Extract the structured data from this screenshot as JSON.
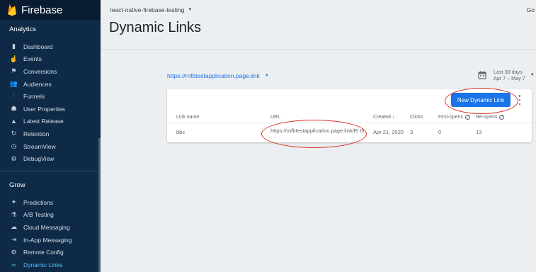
{
  "sidebar": {
    "app_name": "Firebase",
    "analytics_label": "Analytics",
    "analytics_items": [
      {
        "label": "Dashboard",
        "icon": "bar-chart-icon"
      },
      {
        "label": "Events",
        "icon": "touch-icon"
      },
      {
        "label": "Conversions",
        "icon": "flag-icon"
      },
      {
        "label": "Audiences",
        "icon": "people-icon"
      },
      {
        "label": "Funnels",
        "icon": "funnel-icon"
      },
      {
        "label": "User Properties",
        "icon": "user-properties-icon"
      },
      {
        "label": "Latest Release",
        "icon": "release-icon"
      },
      {
        "label": "Retention",
        "icon": "retention-icon"
      },
      {
        "label": "StreamView",
        "icon": "clock-icon"
      },
      {
        "label": "DebugView",
        "icon": "debug-icon"
      }
    ],
    "grow_label": "Grow",
    "grow_items": [
      {
        "label": "Predictions",
        "icon": "magic-wand-icon"
      },
      {
        "label": "A/B Testing",
        "icon": "flask-icon"
      },
      {
        "label": "Cloud Messaging",
        "icon": "cloud-icon"
      },
      {
        "label": "In-App Messaging",
        "icon": "in-app-icon"
      },
      {
        "label": "Remote Config",
        "icon": "remote-config-icon"
      },
      {
        "label": "Dynamic Links",
        "icon": "link-icon",
        "active": true
      }
    ]
  },
  "header": {
    "project": "react-native-firebase-testing",
    "goto": "Go",
    "title": "Dynamic Links"
  },
  "domain": "https://rnfbtestapplication.page.link",
  "date_range": {
    "label": "Last 30 days",
    "range": "Apr 7 – May 7"
  },
  "new_link_button": "New Dynamic Link",
  "table": {
    "columns": {
      "name": "Link name",
      "url": "URL",
      "created": "Created",
      "clicks": "Clicks",
      "first_opens": "First-opens",
      "reopens": "Re-opens"
    },
    "rows": [
      {
        "name": "bbc",
        "url": "https://rnfbtestapplication.page.link/Ei t5",
        "created": "Apr 21, 2020",
        "clicks": "3",
        "first_opens": "0",
        "reopens": "13"
      }
    ]
  },
  "colors": {
    "sidebar_bg": "#0e2a47",
    "accent": "#1a73e8",
    "active_nav": "#4fc3f7",
    "annotation": "#d93025"
  }
}
